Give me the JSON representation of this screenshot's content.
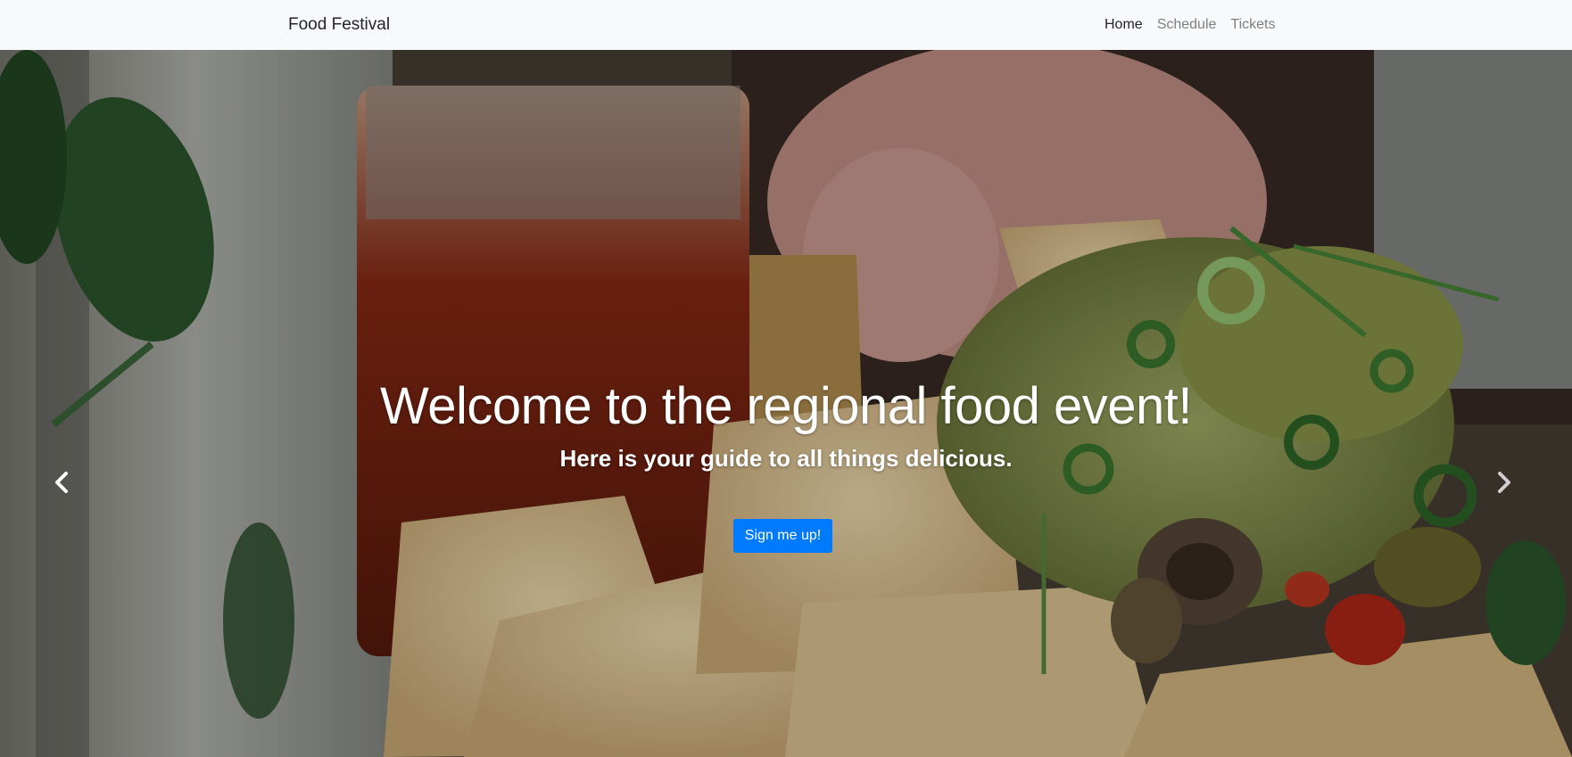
{
  "navbar": {
    "brand": "Food Festival",
    "links": [
      {
        "label": "Home",
        "active": true
      },
      {
        "label": "Schedule",
        "active": false
      },
      {
        "label": "Tickets",
        "active": false
      }
    ]
  },
  "hero": {
    "title": "Welcome to the regional food event!",
    "subtitle": "Here is your guide to all things delicious.",
    "cta_label": "Sign me up!",
    "prev_icon": "chevron-left-icon",
    "next_icon": "chevron-right-icon"
  },
  "colors": {
    "navbar_bg": "#f8f9fa",
    "brand_text": "#212529",
    "link_inactive": "#7f7f7f",
    "cta_bg": "#007bff"
  }
}
